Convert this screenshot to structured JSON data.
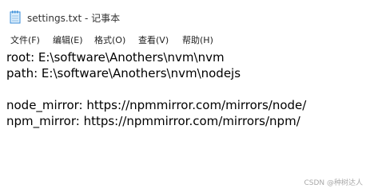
{
  "window": {
    "title": "settings.txt - 记事本"
  },
  "menu": {
    "items": [
      {
        "label": "文件(F)"
      },
      {
        "label": "编辑(E)"
      },
      {
        "label": "格式(O)"
      },
      {
        "label": "查看(V)"
      },
      {
        "label": "帮助(H)"
      }
    ]
  },
  "editor": {
    "lines": [
      "root: E:\\software\\Anothers\\nvm\\nvm",
      "path: E:\\software\\Anothers\\nvm\\nodejs",
      "",
      "node_mirror: https://npmmirror.com/mirrors/node/",
      "npm_mirror: https://npmmirror.com/mirrors/npm/"
    ]
  },
  "watermark": {
    "text": "CSDN @种树达人"
  },
  "icons": {
    "app": "notepad-icon"
  },
  "colors": {
    "icon_blue": "#3b8ed8",
    "icon_light": "#dbeefc"
  }
}
